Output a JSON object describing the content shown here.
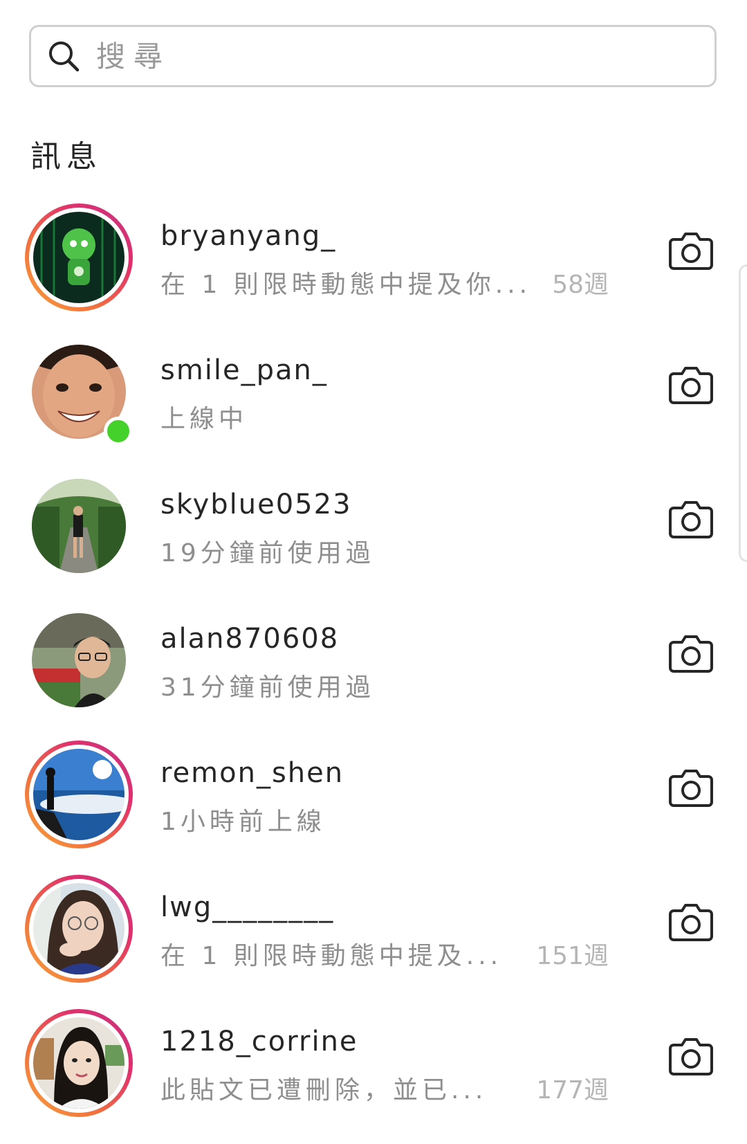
{
  "search": {
    "placeholder": "搜尋",
    "icon": "search-icon"
  },
  "section_title": "訊息",
  "colors": {
    "story_ring_start": "#f9a23b",
    "story_ring_end": "#c13584",
    "online": "#43d12a",
    "secondary_text": "#8e8e8e"
  },
  "conversations": [
    {
      "username": "bryanyang_",
      "subtitle": "在 1 則限時動態中提及你...",
      "time": "58週",
      "story_ring": true,
      "online": false,
      "action_icon": "camera-icon"
    },
    {
      "username": "smile_pan_",
      "subtitle": "上線中",
      "time": "",
      "story_ring": false,
      "online": true,
      "action_icon": "camera-icon"
    },
    {
      "username": "skyblue0523",
      "subtitle": "19分鐘前使用過",
      "time": "",
      "story_ring": false,
      "online": false,
      "action_icon": "camera-icon"
    },
    {
      "username": "alan870608",
      "subtitle": "31分鐘前使用過",
      "time": "",
      "story_ring": false,
      "online": false,
      "action_icon": "camera-icon"
    },
    {
      "username": "remon_shen",
      "subtitle": "1小時前上線",
      "time": "",
      "story_ring": true,
      "online": false,
      "action_icon": "camera-icon"
    },
    {
      "username": "lwg________",
      "subtitle": "在 1 則限時動態中提及...",
      "time": "151週",
      "story_ring": true,
      "online": false,
      "action_icon": "camera-icon"
    },
    {
      "username": "1218_corrine",
      "subtitle": "此貼文已遭刪除，並已...",
      "time": "177週",
      "story_ring": true,
      "online": false,
      "action_icon": "camera-icon"
    }
  ]
}
